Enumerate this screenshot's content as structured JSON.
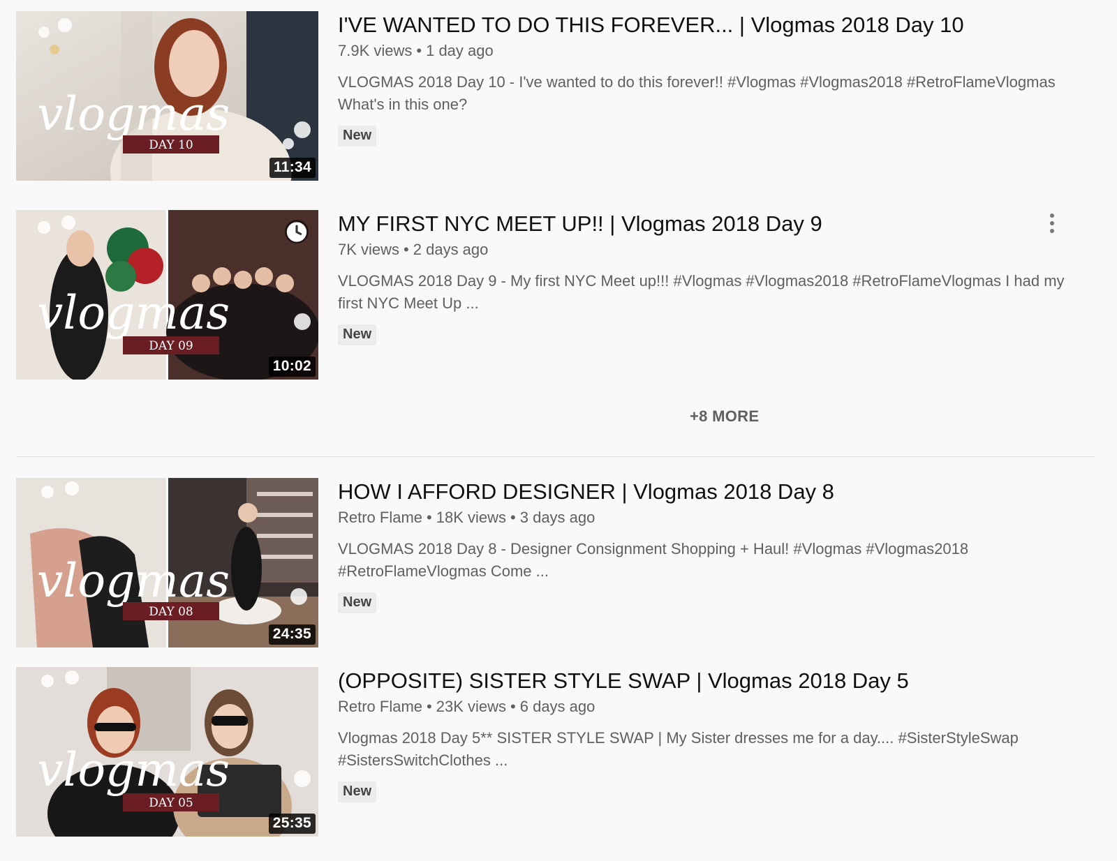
{
  "videos": [
    {
      "title": "I'VE WANTED TO DO THIS FOREVER... | Vlogmas 2018 Day 10",
      "channel": "",
      "views": "7.9K views",
      "age": "1 day ago",
      "description": "VLOGMAS 2018 Day 10 - I've wanted to do this forever!! #Vlogmas #Vlogmas2018 #RetroFlameVlogmas What's in this one?",
      "badge": "New",
      "duration": "11:34",
      "thumb_script": "vlogmas",
      "thumb_day": "DAY 10"
    },
    {
      "title": "MY FIRST NYC MEET UP!! | Vlogmas 2018 Day 9",
      "channel": "",
      "views": "7K views",
      "age": "2 days ago",
      "description": "VLOGMAS 2018 Day 9 - My first NYC Meet up!!! #Vlogmas #Vlogmas2018 #RetroFlameVlogmas I had my first NYC Meet Up ...",
      "badge": "New",
      "duration": "10:02",
      "thumb_script": "vlogmas",
      "thumb_day": "DAY 09"
    },
    {
      "title": "HOW I AFFORD DESIGNER | Vlogmas 2018 Day 8",
      "channel": "Retro Flame",
      "views": "18K views",
      "age": "3 days ago",
      "description": "VLOGMAS 2018 Day 8 - Designer Consignment Shopping + Haul! #Vlogmas #Vlogmas2018 #RetroFlameVlogmas Come ...",
      "badge": "New",
      "duration": "24:35",
      "thumb_script": "vlogmas",
      "thumb_day": "DAY 08"
    },
    {
      "title": "(OPPOSITE) SISTER STYLE SWAP | Vlogmas 2018 Day 5",
      "channel": "Retro Flame",
      "views": "23K views",
      "age": "6 days ago",
      "description": "Vlogmas 2018 Day 5** SISTER STYLE SWAP | My Sister dresses me for a day.... #SisterStyleSwap #SistersSwitchClothes ...",
      "badge": "New",
      "duration": "25:35",
      "thumb_script": "vlogmas",
      "thumb_day": "DAY 05"
    }
  ],
  "more_label": "+8 MORE",
  "icons": {
    "watch_later": "clock-icon",
    "menu": "more-vert-icon"
  },
  "colors": {
    "background": "#f9f9f9",
    "title": "#0f0f0f",
    "meta": "#606060",
    "badge_bg": "#ececec",
    "day_banner": "#6b1d24"
  }
}
